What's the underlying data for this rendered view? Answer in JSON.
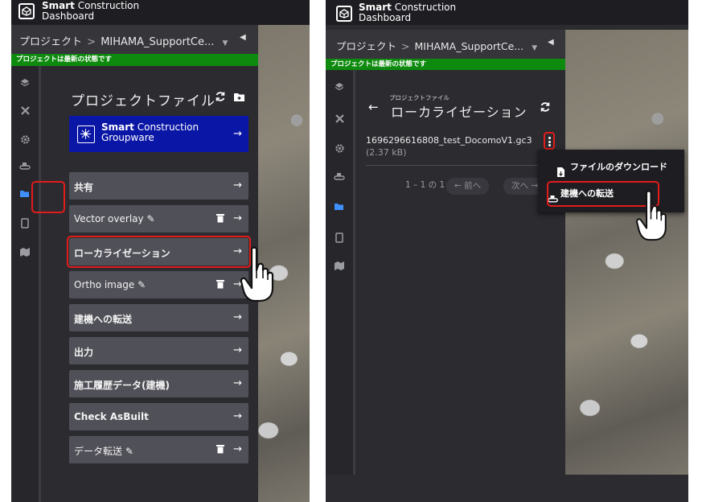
{
  "app": {
    "brand_line1_bold": "Smart",
    "brand_line1_rest": " Construction",
    "brand_line2": "Dashboard"
  },
  "breadcrumb": {
    "root": "プロジェクト",
    "separator": ">",
    "project": "MIHAMA_SupportCe..."
  },
  "status": {
    "text": "プロジェクトは最新の状態です",
    "color": "#0e8a0e"
  },
  "left": {
    "title": "プロジェクトファイル",
    "groupware": {
      "line1_bold": "Smart",
      "line1_rest": " Construction",
      "line2": "Groupware",
      "color": "#0a16a6"
    },
    "items": [
      {
        "label": "共有"
      },
      {
        "label": "Vector overlay"
      },
      {
        "label": "ローカライゼーション"
      },
      {
        "label": "Ortho image"
      },
      {
        "label": "建機への転送"
      },
      {
        "label": "出力"
      },
      {
        "label": "施工履歴データ(建機)"
      },
      {
        "label": "Check AsBuilt"
      },
      {
        "label": "データ転送"
      }
    ]
  },
  "right": {
    "subtitle": "プロジェクトファイル",
    "title": "ローカライゼーション",
    "file_name": "1696296616808_test_DocomoV1.gc3",
    "file_size": "(2.37 kB)",
    "pagination": {
      "range": "1 – 1 の 1",
      "prev_label": "← 前へ",
      "next_label": "次へ →"
    },
    "menu": {
      "download_label": "ファイルのダウンロード",
      "transfer_label": "建機への転送"
    }
  },
  "icons": {
    "rail": [
      "layers-icon",
      "tools-icon",
      "gear-icon",
      "machine-icon",
      "folder-icon",
      "tablet-icon",
      "map-icon"
    ],
    "refresh": "refresh-icon",
    "back": "back-arrow-icon",
    "kebab": "more-vert-icon"
  },
  "colors": {
    "highlight": "#e21b1b",
    "active_rail": "#3f8fff",
    "panel_bg": "#2b2b30",
    "item_bg": "#505058"
  }
}
